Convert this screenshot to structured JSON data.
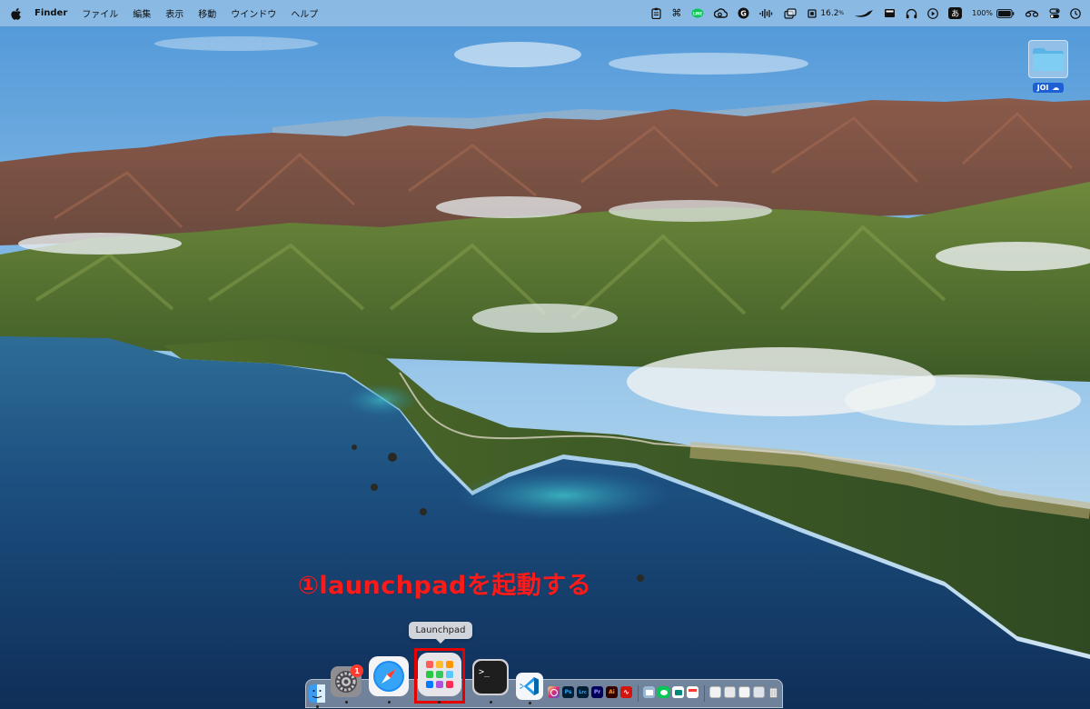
{
  "menubar": {
    "app_name": "Finder",
    "menus": [
      "ファイル",
      "編集",
      "表示",
      "移動",
      "ウインドウ",
      "ヘルプ"
    ],
    "status_icons": [
      "clipboard-icon",
      "command-icon",
      "line-icon",
      "creative-cloud-icon",
      "grammarly-icon",
      "audio-wave-icon",
      "screens-icon",
      "cpu-stats-icon",
      "swift-icon",
      "display-icon",
      "headphones-icon",
      "play-icon",
      "input-method-icon",
      "battery-icon",
      "wifi-icon",
      "control-center-icon",
      "clock-icon"
    ],
    "cpu_value": "16.2",
    "cpu_unit": "%",
    "input_method": "あ",
    "battery_percent": "100%"
  },
  "desktop": {
    "folder_label": "JOI",
    "folder_label_suffix": "☁"
  },
  "annotation": {
    "text": "①launchpadを起動する",
    "color": "#ff1a1a"
  },
  "tooltip": {
    "label": "Launchpad"
  },
  "dock": {
    "settings_badge": "1",
    "apps": [
      "Finder",
      "System Settings",
      "Safari",
      "Launchpad",
      "Terminal",
      "Visual Studio Code",
      "Instagram",
      "Photoshop",
      "Lightroom Classic",
      "Premiere Pro",
      "Illustrator",
      "Acrobat",
      "Preview",
      "LINE",
      "Google Meet",
      "Calendar"
    ],
    "mini_labels": {
      "ps": "Ps",
      "lrc": "Lrc",
      "pr": "Pr",
      "ai": "Ai"
    }
  },
  "colors": {
    "highlight": "#e60000",
    "folder_label_bg": "#1f5fd4"
  }
}
